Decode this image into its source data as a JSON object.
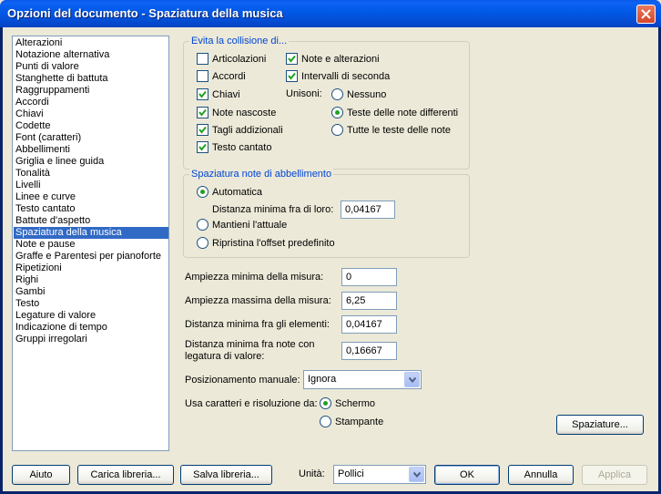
{
  "window": {
    "title": "Opzioni del documento - Spaziatura della musica"
  },
  "categories": [
    "Alterazioni",
    "Notazione alternativa",
    "Punti di valore",
    "Stanghette di battuta",
    "Raggruppamenti",
    "Accordi",
    "Chiavi",
    "Codette",
    "Font (caratteri)",
    "Abbellimenti",
    "Griglia e linee guida",
    "Tonalità",
    "Livelli",
    "Linee e curve",
    "Testo cantato",
    "Battute d'aspetto",
    "Spaziatura della musica",
    "Note e pause",
    "Graffe e Parentesi per pianoforte",
    "Ripetizioni",
    "Righi",
    "Gambi",
    "Testo",
    "Legature di valore",
    "Indicazione di tempo",
    "Gruppi irregolari"
  ],
  "selected_category": "Spaziatura della musica",
  "collision": {
    "legend": "Evita la collisione di...",
    "articolazioni": "Articolazioni",
    "note_alterazioni": "Note e alterazioni",
    "accordi": "Accordi",
    "intervalli": "Intervalli di seconda",
    "chiavi": "Chiavi",
    "unisoni_label": "Unisoni:",
    "nessuno": "Nessuno",
    "note_nascoste": "Note nascoste",
    "teste_differenti": "Teste delle note differenti",
    "tagli": "Tagli addizionali",
    "tutte_teste": "Tutte le teste delle note",
    "testo_cantato": "Testo cantato"
  },
  "grace": {
    "legend": "Spaziatura note di abbellimento",
    "automatica": "Automatica",
    "distanza_label": "Distanza minima fra di loro:",
    "distanza_value": "0,04167",
    "mantieni": "Mantieni l'attuale",
    "ripristina": "Ripristina l'offset predefinito"
  },
  "measures": {
    "min_width_label": "Ampiezza minima della misura:",
    "min_width_value": "0",
    "max_width_label": "Ampiezza massima della misura:",
    "max_width_value": "6,25",
    "min_dist_label": "Distanza minima fra gli elementi:",
    "min_dist_value": "0,04167",
    "tied_label_1": "Distanza minima fra note con",
    "tied_label_2": "legatura di valore:",
    "tied_value": "0,16667"
  },
  "manual": {
    "label": "Posizionamento manuale:",
    "value": "Ignora"
  },
  "resolution": {
    "label": "Usa caratteri e risoluzione da:",
    "schermo": "Schermo",
    "stampante": "Stampante"
  },
  "buttons": {
    "spaziature": "Spaziature...",
    "aiuto": "Aiuto",
    "carica": "Carica libreria...",
    "salva": "Salva libreria...",
    "ok": "OK",
    "annulla": "Annulla",
    "applica": "Applica"
  },
  "units": {
    "label": "Unità:",
    "value": "Pollici"
  },
  "colors": {
    "accent": "#316ac5",
    "legend": "#0046d5",
    "check": "#21a121"
  }
}
